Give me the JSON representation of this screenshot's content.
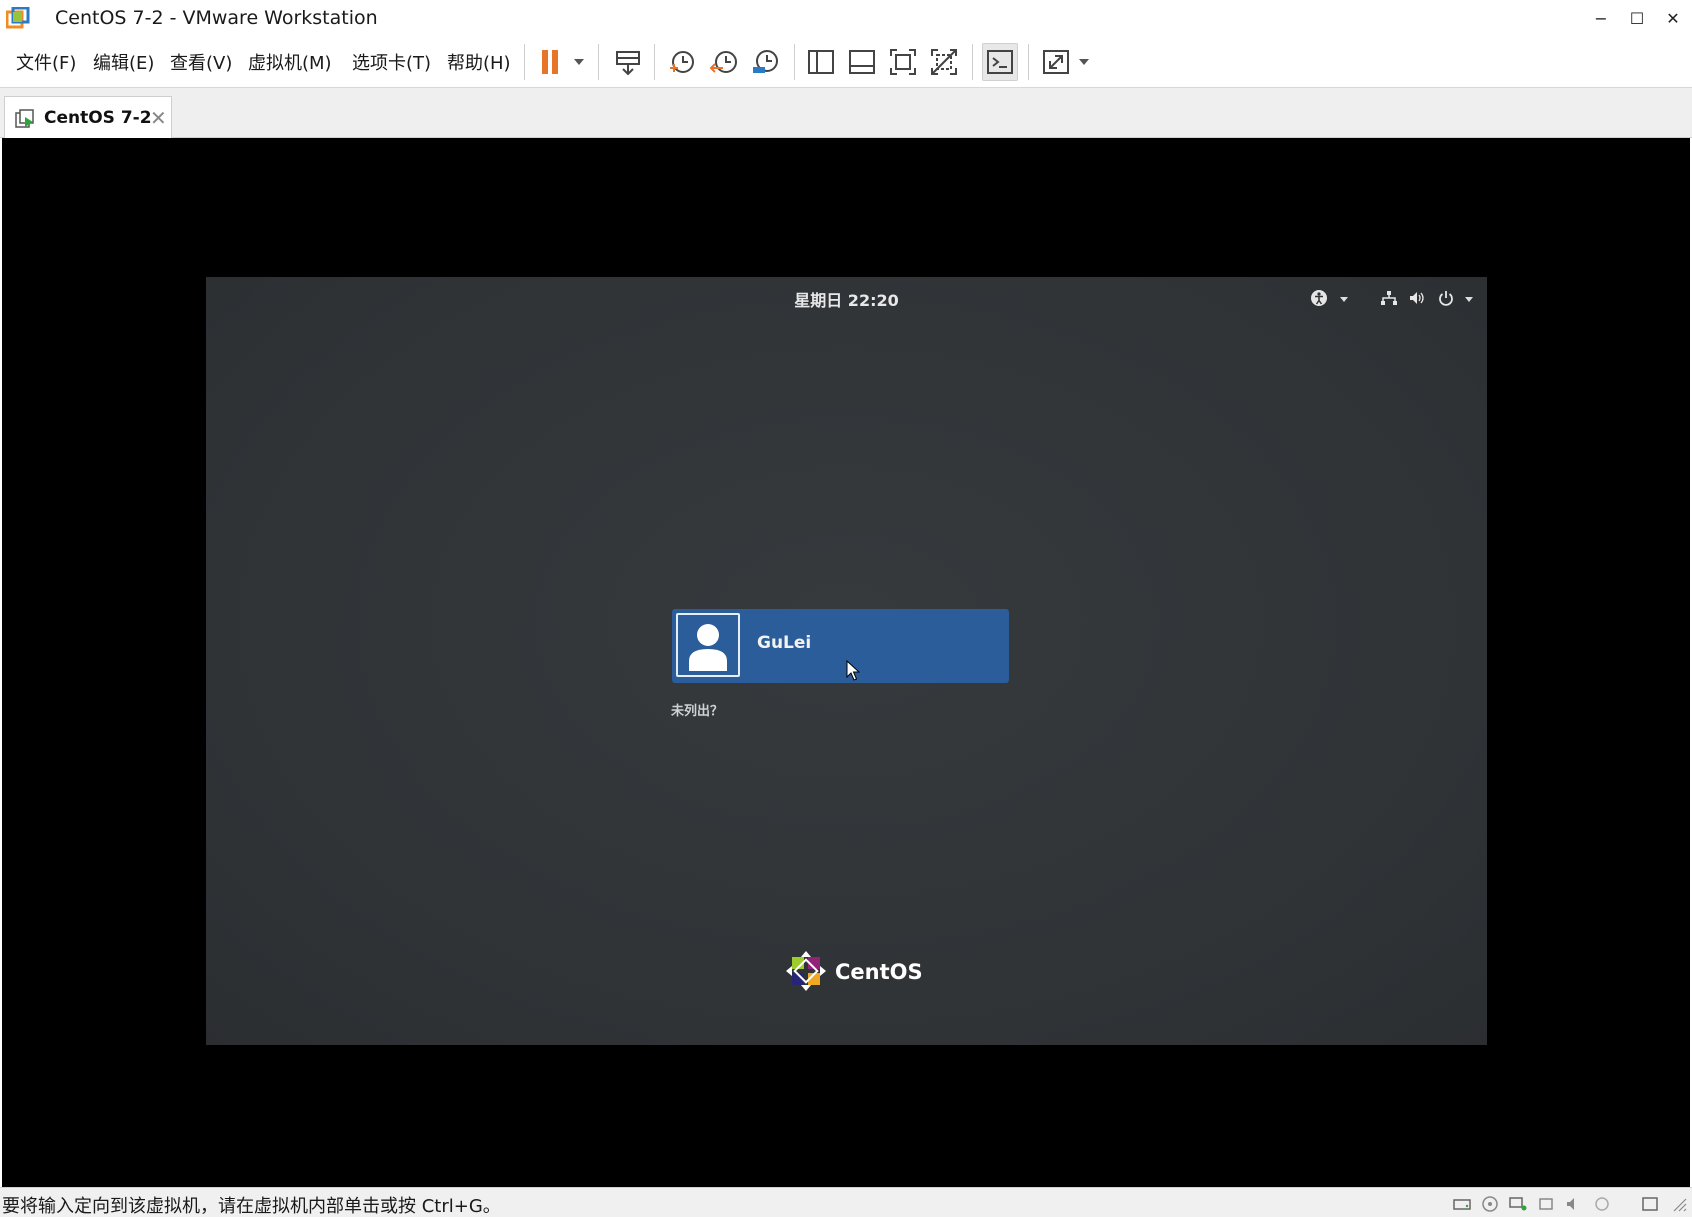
{
  "window": {
    "title": "CentOS 7-2 - VMware Workstation",
    "minimize": "−",
    "maximize": "☐",
    "close": "✕"
  },
  "menu": {
    "file": "文件(F)",
    "edit": "编辑(E)",
    "view": "查看(V)",
    "vm": "虚拟机(M)",
    "tabs": "选项卡(T)",
    "help": "帮助(H)"
  },
  "toolbar": {
    "icons": [
      "pause-icon",
      "send-ctrl-alt-del-icon",
      "snapshot-icon",
      "revert-snapshot-icon",
      "snapshot-manager-icon",
      "show-library-icon",
      "thumbnail-bar-icon",
      "full-screen-icon",
      "unity-icon",
      "console-view-icon",
      "stretch-guest-icon"
    ],
    "accent": "#e8742a"
  },
  "tab": {
    "label": "CentOS 7-2",
    "close": "✕"
  },
  "guest": {
    "clock": "星期日 22:20",
    "user_name": "GuLei",
    "not_listed": "未列出？",
    "logo_text": "CentOS",
    "selected_color": "#2a5d9a"
  },
  "status": {
    "message": "要将输入定向到该虚拟机，请在虚拟机内部单击或按 Ctrl+G。"
  }
}
